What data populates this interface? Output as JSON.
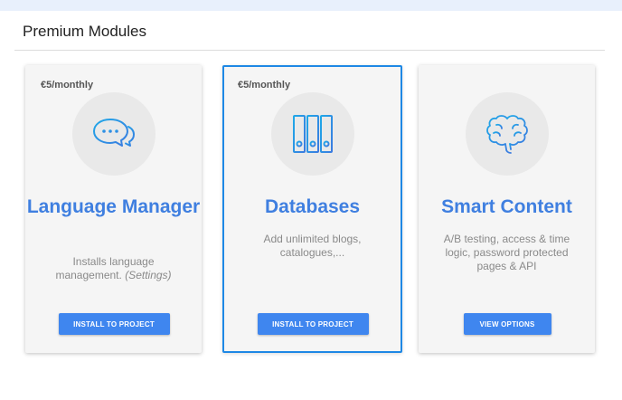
{
  "panel": {
    "title": "Premium Modules"
  },
  "cards": [
    {
      "price": "€5/monthly",
      "icon": "chat-bubbles-icon",
      "title": "Language Manager",
      "desc": "Installs language management.",
      "desc_note": "(Settings)",
      "button": "INSTALL TO PROJECT"
    },
    {
      "price": "€5/monthly",
      "icon": "database-binders-icon",
      "title": "Databases",
      "desc": "Add unlimited blogs, catalogues,...",
      "button": "INSTALL TO PROJECT",
      "selected": true
    },
    {
      "icon": "brain-icon",
      "title": "Smart Content",
      "desc": "A/B testing, access & time logic, password protected pages & API",
      "button": "VIEW OPTIONS"
    }
  ],
  "colors": {
    "accent": "#3f86ef",
    "title_blue": "#3f7fe0",
    "selected_border": "#1e88e5",
    "icon_gradient_start": "#1fa8e8",
    "icon_gradient_end": "#3b7be0"
  }
}
